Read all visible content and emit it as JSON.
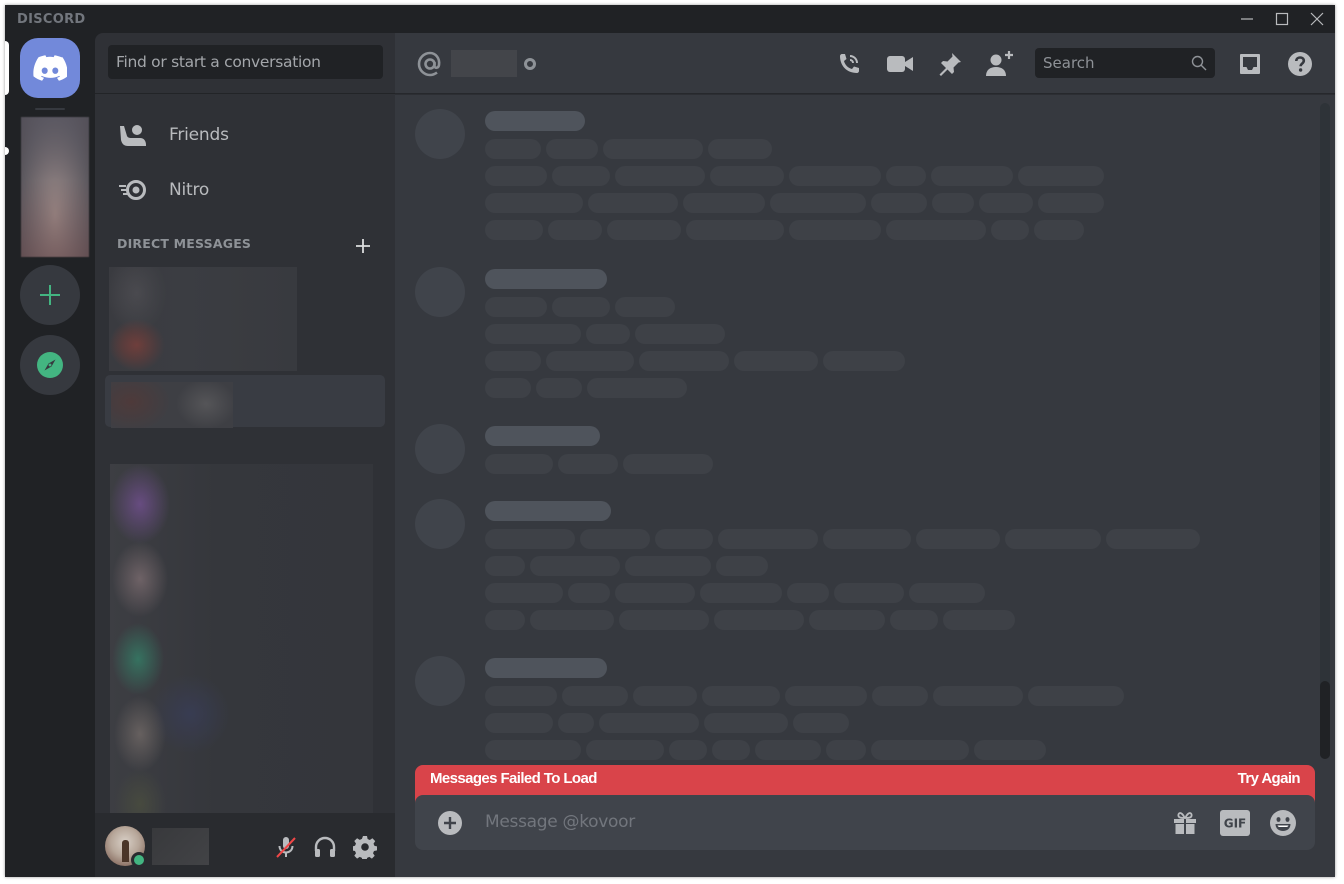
{
  "app": {
    "wordmark": "DISCORD",
    "window_controls": {
      "minimize": "minimize-icon",
      "maximize": "maximize-icon",
      "close": "close-icon"
    }
  },
  "server_rail": {
    "home": {
      "icon": "discord-logo-icon",
      "selected": true
    },
    "servers": [
      {
        "icon": "server-image-blurred",
        "has_unread": true
      }
    ],
    "add_server": {
      "icon": "plus-icon",
      "color": "#43b581"
    },
    "explore": {
      "icon": "compass-icon",
      "color": "#43b581"
    }
  },
  "sidebar": {
    "search_placeholder": "Find or start a conversation",
    "nav": [
      {
        "label": "Friends",
        "icon": "friends-icon"
      },
      {
        "label": "Nitro",
        "icon": "nitro-icon"
      }
    ],
    "dm_header": "Direct Messages",
    "dm_add_icon": "plus-icon",
    "dm_items": [
      {
        "blurred": true,
        "selected": false
      },
      {
        "blurred": true,
        "selected": true
      },
      {
        "blurred": true,
        "selected": false
      }
    ],
    "user_panel": {
      "status": "online",
      "status_color": "#43b581",
      "username_blurred": true,
      "buttons": [
        {
          "name": "mute",
          "icon": "microphone-muted-icon",
          "state": "muted"
        },
        {
          "name": "deafen",
          "icon": "headphones-icon"
        },
        {
          "name": "settings",
          "icon": "gear-icon"
        }
      ]
    }
  },
  "chat": {
    "header": {
      "icon": "at-icon",
      "name_blurred": true,
      "status": "offline",
      "actions": [
        {
          "name": "start-voice-call",
          "icon": "phone-call-icon"
        },
        {
          "name": "start-video-call",
          "icon": "video-camera-icon"
        },
        {
          "name": "pinned-messages",
          "icon": "pin-icon"
        },
        {
          "name": "add-friends-to-dm",
          "icon": "add-user-icon"
        }
      ],
      "search_placeholder": "Search",
      "inbox_icon": "inbox-icon",
      "help_icon": "help-icon"
    },
    "loading_skeleton": true,
    "error": {
      "message": "Messages Failed To Load",
      "action": "Try Again",
      "color": "#d9444a"
    },
    "composer": {
      "placeholder": "Message @kovoor",
      "attach_icon": "plus-circle-icon",
      "buttons": [
        {
          "name": "gift",
          "icon": "gift-icon"
        },
        {
          "name": "gif",
          "icon": "gif-icon",
          "label": "GIF"
        },
        {
          "name": "emoji",
          "icon": "emoji-icon"
        }
      ]
    }
  },
  "colors": {
    "brand": "#7289da",
    "green": "#43b581",
    "danger": "#d9444a",
    "bg_tertiary": "#202225",
    "bg_secondary": "#2f3136",
    "bg_primary": "#36393f"
  }
}
